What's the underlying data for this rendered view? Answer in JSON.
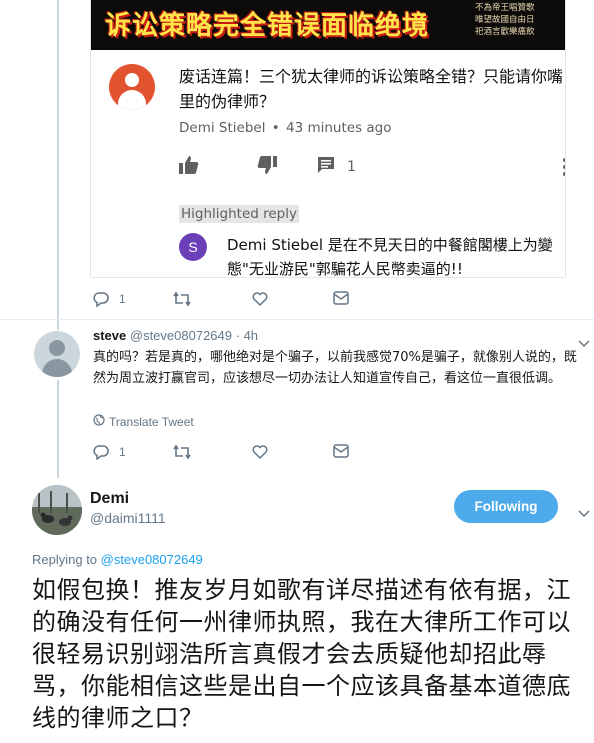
{
  "youtube_card": {
    "banner_title": "诉讼策略完全错误面临绝境",
    "banner_side_lines": [
      "不為帝王唱贊歌",
      "唯望故國自由日",
      "祀酒言歡樂痛飲"
    ],
    "comment": {
      "text": "废话连篇！三个犹太律师的诉讼策略全错？只能请你嘴里的伪律师？",
      "author": "Demi Stiebel",
      "time": "43 minutes ago",
      "reply_count": "1"
    },
    "highlighted_label": "Highlighted reply",
    "reply": {
      "avatar_letter": "S",
      "text": "Demi Stiebel 是在不見天日的中餐館閣樓上为變態\"无业游民\"郭騙花人民幣卖逼的!!"
    }
  },
  "top_tweet_actions": {
    "reply_count": "1"
  },
  "steve_tweet": {
    "name": "steve",
    "handle": "@steve08072649",
    "separator": "·",
    "time": "4h",
    "text": "真的吗？若是真的，哪他绝对是个骗子，以前我感觉70%是骗子，就像别人说的，既然为周立波打赢官司，应该想尽一切办法让人知道宣传自己，看这位一直很低调。",
    "translate_label": "Translate Tweet",
    "reply_count": "1"
  },
  "demi_tweet": {
    "name": "Demi",
    "handle": "@daimi1111",
    "follow_label": "Following",
    "replying_prefix": "Replying to",
    "replying_handle": "@steve08072649",
    "text": "如假包换！推友岁月如歌有详尽描述有依有据，江的确没有任何一州律师执照，我在大律所工作可以很轻易识别翊浩所言真假才会去质疑他却招此辱骂，你能相信这些是出自一个应该具备基本道德底线的律师之口？"
  },
  "colors": {
    "twitter_blue": "#1da1f2",
    "follow_button": "#4dabeb",
    "muted_text": "#657786",
    "youtube_avatar": "#e2542f",
    "reply_avatar": "#6b3fb8"
  }
}
